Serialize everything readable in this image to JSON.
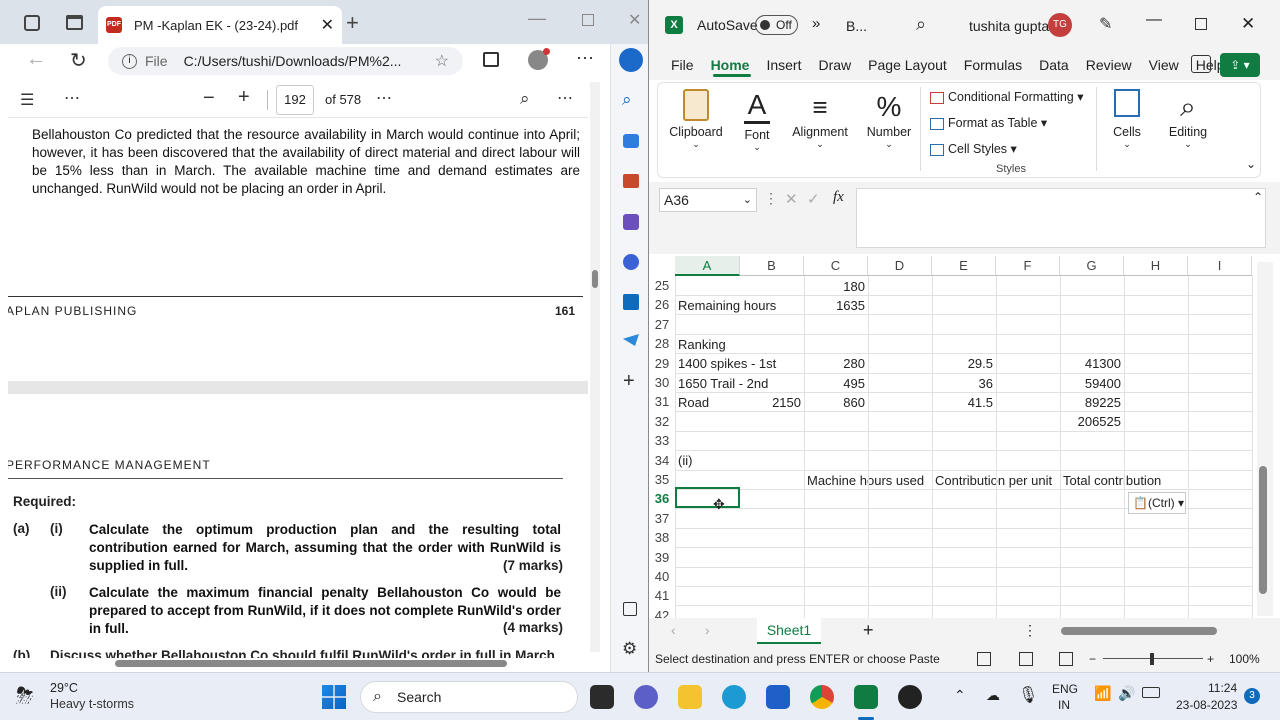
{
  "edge": {
    "tab_title": "PM -Kaplan EK - (23-24).pdf",
    "url_prefix": "File",
    "url": "C:/Users/tushi/Downloads/PM%2...",
    "page_current": "192",
    "page_total": "of 578",
    "paragraph": "Bellahouston Co predicted that the resource availability in March would continue into April; however, it has been discovered that the availability of direct material and direct labour will be 15% less than in March. The available machine time and demand estimates are unchanged. RunWild would not be placing an order in April.",
    "footer_left": "APLAN PUBLISHING",
    "footer_page": "161",
    "header2": "PERFORMANCE MANAGEMENT",
    "required": "Required:",
    "qa_label": "(a)",
    "q1_label": "(i)",
    "q1_text": "Calculate the optimum production plan and the resulting total contribution earned for March, assuming that the order with RunWild is supplied in full.",
    "q1_marks": "(7 marks)",
    "q2_label": "(ii)",
    "q2_text": "Calculate the maximum financial penalty Bellahouston Co would be prepared to accept from RunWild, if it does not complete RunWild's order in full.",
    "q2_marks": "(4 marks)",
    "q3_label": "(b)",
    "q3_text": "Discuss whether Bellahouston Co should fulfil RunWild's order in full in March"
  },
  "excel": {
    "autosave": "AutoSave",
    "autosave_state": "Off",
    "more": "»",
    "file_name": "B...",
    "user": "tushita gupta",
    "avatar_initials": "TG",
    "menu": [
      "File",
      "Home",
      "Insert",
      "Draw",
      "Page Layout",
      "Formulas",
      "Data",
      "Review",
      "View",
      "Help"
    ],
    "ribbon": {
      "clipboard": "Clipboard",
      "font": "Font",
      "alignment": "Alignment",
      "number": "Number",
      "cond_format": "Conditional Formatting",
      "format_table": "Format as Table",
      "cell_styles": "Cell Styles",
      "styles": "Styles",
      "cells": "Cells",
      "editing": "Editing"
    },
    "name_box": "A36",
    "fx": "fx",
    "columns": [
      "A",
      "B",
      "C",
      "D",
      "E",
      "F",
      "G",
      "H",
      "I"
    ],
    "rows": [
      {
        "n": "25",
        "c": {
          "C": "180"
        }
      },
      {
        "n": "26",
        "c": {
          "A": "Remaining hours",
          "C": "1635"
        }
      },
      {
        "n": "27",
        "c": {}
      },
      {
        "n": "28",
        "c": {
          "A": "Ranking"
        }
      },
      {
        "n": "29",
        "c": {
          "A": "1400 spikes - 1st",
          "C": "280",
          "E": "29.5",
          "G": "41300"
        }
      },
      {
        "n": "30",
        "c": {
          "A": "1650 Trail - 2nd",
          "C": "495",
          "E": "36",
          "G": "59400"
        }
      },
      {
        "n": "31",
        "c": {
          "A": "Road",
          "B": "2150",
          "C": "860",
          "E": "41.5",
          "G": "89225"
        }
      },
      {
        "n": "32",
        "c": {
          "G": "206525"
        }
      },
      {
        "n": "33",
        "c": {}
      },
      {
        "n": "34",
        "c": {
          "A": "(ii)"
        }
      },
      {
        "n": "35",
        "c": {
          "C": "Machine hours used",
          "E": "Contribution per unit",
          "G": "Total contribution"
        }
      },
      {
        "n": "36",
        "c": {}
      },
      {
        "n": "37",
        "c": {}
      },
      {
        "n": "38",
        "c": {}
      },
      {
        "n": "39",
        "c": {}
      },
      {
        "n": "40",
        "c": {}
      },
      {
        "n": "41",
        "c": {}
      },
      {
        "n": "42",
        "c": {}
      }
    ],
    "paste_tag": "(Ctrl)",
    "sheet_tab": "Sheet1",
    "status_text": "Select destination and press ENTER or choose Paste",
    "zoom": "100%"
  },
  "taskbar": {
    "temp": "29°C",
    "weather": "Heavy t-storms",
    "search": "Search",
    "lang1": "ENG",
    "lang2": "IN",
    "time": "11:24",
    "date": "23-08-2023",
    "notif": "3"
  },
  "colors": {
    "excel_green": "#107c41",
    "accent_blue": "#0f6cbd",
    "pdf_red": "#c42b1c"
  }
}
